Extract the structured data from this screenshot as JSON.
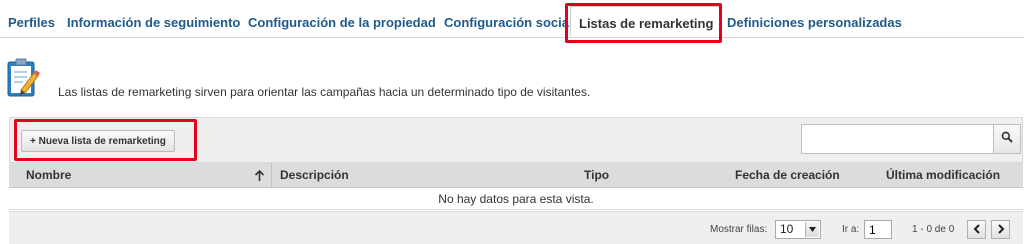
{
  "tabs": [
    {
      "label": "Perfiles"
    },
    {
      "label": "Información de seguimiento"
    },
    {
      "label": "Configuración de la propiedad"
    },
    {
      "label": "Configuración social"
    },
    {
      "label": "Listas de remarketing",
      "active": true
    },
    {
      "label": "Definiciones personalizadas"
    }
  ],
  "info": {
    "icon": "clipboard-pencil-icon",
    "text": "Las listas de remarketing sirven para orientar las campañas hacia un determinado tipo de visitantes."
  },
  "toolbar": {
    "new_button_label": "+ Nueva lista de remarketing",
    "search_placeholder": "",
    "search_icon": "search-icon"
  },
  "table": {
    "columns": [
      {
        "label": "Nombre",
        "sort": "ascending"
      },
      {
        "label": "Descripción"
      },
      {
        "label": "Tipo"
      },
      {
        "label": "Fecha de creación"
      },
      {
        "label": "Última modificación"
      }
    ],
    "empty_message": "No hay datos para esta vista."
  },
  "pagination": {
    "rows_label": "Mostrar filas:",
    "rows_value": "10",
    "goto_label": "Ir a:",
    "goto_value": "1",
    "range_text": "1 - 0 de 0"
  },
  "highlight_color": "#e3001b"
}
